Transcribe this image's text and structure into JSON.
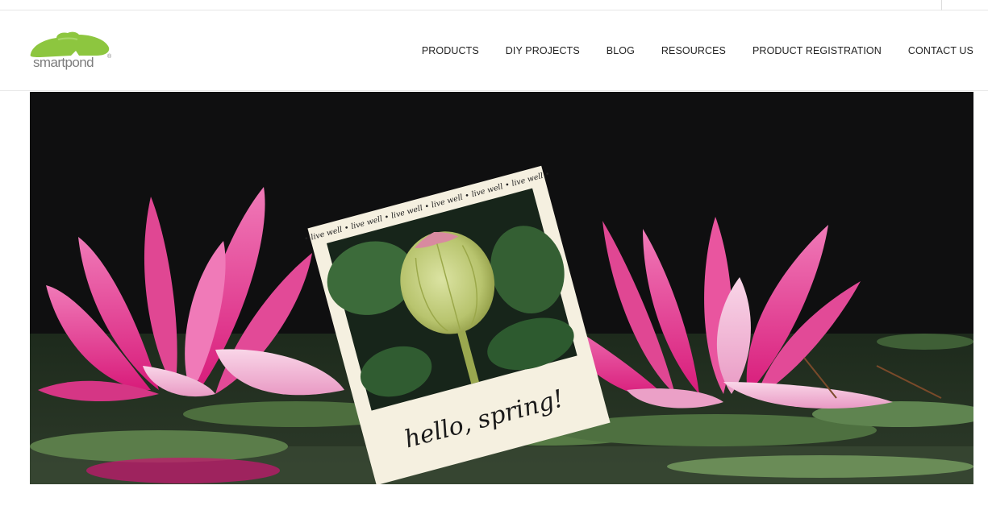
{
  "brand": {
    "name": "smartpond",
    "registered_mark": "®",
    "logo_color": "#8dc63f"
  },
  "nav": {
    "items": [
      {
        "label": "PRODUCTS"
      },
      {
        "label": "DIY PROJECTS"
      },
      {
        "label": "BLOG"
      },
      {
        "label": "RESOURCES"
      },
      {
        "label": "PRODUCT REGISTRATION"
      },
      {
        "label": "CONTACT US"
      }
    ]
  },
  "hero": {
    "polaroid_border_text": "• live well • live well • live well • live well • live well • live well •",
    "polaroid_caption": "hello, spring!",
    "colors": {
      "background": "#0f0f10",
      "lily_pink": "#e8338f",
      "polaroid_frame": "#f5f0e0",
      "pad_green": "#3c6b3a"
    }
  }
}
